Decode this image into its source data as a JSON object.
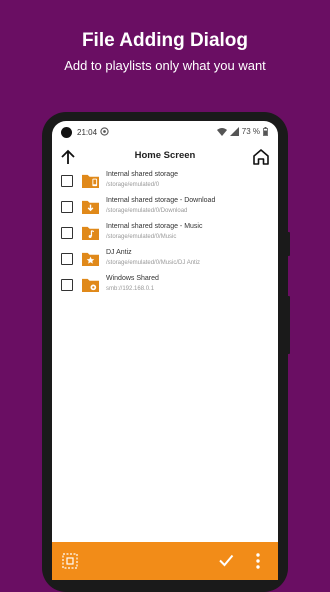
{
  "promo": {
    "title": "File Adding Dialog",
    "subtitle": "Add to playlists only what you want"
  },
  "status_bar": {
    "time": "21:04",
    "battery": "73 %"
  },
  "app_bar": {
    "title": "Home Screen",
    "back_icon": "arrow-up-icon",
    "home_icon": "home-icon"
  },
  "items": [
    {
      "name": "Internal shared storage",
      "path": "/storage/emulated/0",
      "icon": "folder-phone-icon",
      "checked": false
    },
    {
      "name": "Internal shared storage - Download",
      "path": "/storage/emulated/0/Download",
      "icon": "folder-download-icon",
      "checked": false
    },
    {
      "name": "Internal shared storage - Music",
      "path": "/storage/emulated/0/Music",
      "icon": "folder-music-icon",
      "checked": false
    },
    {
      "name": "DJ Antiz",
      "path": "/storage/emulated/0/Music/DJ Antiz",
      "icon": "folder-star-icon",
      "checked": false
    },
    {
      "name": "Windows Shared",
      "path": "smb://192.168.0.1",
      "icon": "folder-network-icon",
      "checked": false
    }
  ],
  "bottom_bar": {
    "select_all_icon": "select-all-icon",
    "confirm_icon": "check-icon",
    "more_icon": "more-vert-icon"
  },
  "colors": {
    "background": "#6a0e63",
    "accent": "#f28c18",
    "folder": "#e0891a"
  }
}
